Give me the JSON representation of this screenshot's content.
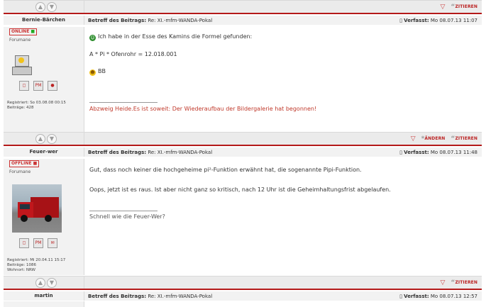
{
  "colors": {
    "accent_red": "#b41a1a",
    "signature": "#c0392b",
    "header_bg": "#f2f2f2",
    "bar_bg": "#ebebeb"
  },
  "icons": [
    "up-arrow-icon",
    "down-arrow-icon",
    "report-triangle-icon",
    "quote-icon",
    "edit-icon",
    "profile-icon",
    "pm-icon",
    "www-icon",
    "email-icon"
  ],
  "toolbar": {
    "quote_label": "ZITIEREN",
    "edit_label": "ÄNDERN"
  },
  "posts": [
    {
      "username": "Bernie-Bärchen",
      "status": "ONLINE",
      "rank": "Forumane",
      "subject_label": "Betreff des Beitrags:",
      "subject": "Re: XI.-mfm-WANDA-Pokal",
      "time_label": "Verfasst:",
      "time": "Mo 08.07.13 11:07",
      "registered": "Registriert: So 03.08.08 00:15",
      "posts_count": "Beiträge: 428",
      "lines": [
        "Ich habe in der Esse des Kamins die Formel gefunden:",
        "A * Pi * Ofenrohr = 12.018.001",
        "BB"
      ],
      "signature": "Abzweig Heide.Es ist soweit: Der Wiederaufbau der Bildergalerie hat begonnen!"
    },
    {
      "username": "Feuer-wer",
      "status": "OFFLINE",
      "rank": "Forumane",
      "subject_label": "Betreff des Beitrags:",
      "subject": "Re: XI.-mfm-WANDA-Pokal",
      "time_label": "Verfasst:",
      "time": "Mo 08.07.13 11:48",
      "registered": "Registriert: Mi 20.04.11 15:17",
      "posts_count": "Beiträge: 1086",
      "location": "Wohnort: NRW",
      "lines": [
        "Gut, dass noch keiner die hochgeheime pi²-Funktion erwähnt hat, die sogenannte Pipi-Funktion.",
        "Oops, jetzt ist es raus. Ist aber nicht ganz so kritisch, nach 12 Uhr ist die Geheimhaltungsfrist abgelaufen."
      ],
      "signature": "Schnell wie die Feuer-Wer?"
    },
    {
      "username": "martin",
      "subject_label": "Betreff des Beitrags:",
      "subject": "Re: XI.-mfm-WANDA-Pokal",
      "time_label": "Verfasst:",
      "time": "Mo 08.07.13 12:57"
    }
  ]
}
